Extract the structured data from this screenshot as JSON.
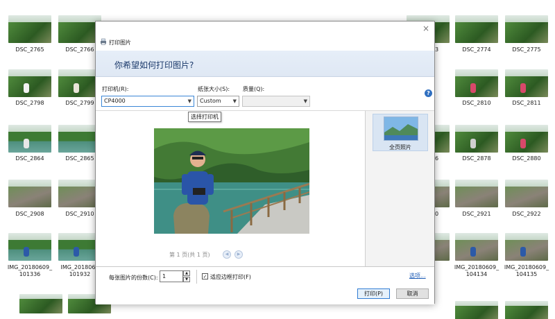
{
  "gallery": {
    "labels": [
      "DSC_2765",
      "DSC_2766",
      "73",
      "DSC_2774",
      "DSC_2775",
      "DSC_2798",
      "DSC_2799",
      "DSC_2810",
      "DSC_2811",
      "DSC_2864",
      "DSC_2865",
      "76",
      "DSC_2878",
      "DSC_2880",
      "DSC_2908",
      "DSC_2910",
      "20",
      "DSC_2921",
      "DSC_2922"
    ],
    "img_left": [
      "IMG_20180609_",
      "101336"
    ],
    "img_mid": [
      "IMG_2018060",
      "101932"
    ],
    "img_right1": [
      "IMG_20180609_",
      "104134"
    ],
    "img_right2": [
      "IMG_20180609_",
      "104135"
    ]
  },
  "dialog": {
    "title": "打印图片",
    "close_glyph": "×",
    "heading": "你希望如何打印图片?",
    "printer_label": "打印机(R):",
    "printer_value": "CP4000",
    "paper_label": "纸张大小(S):",
    "paper_value": "Custom",
    "quality_label": "质量(Q):",
    "quality_value": "",
    "help_glyph": "?",
    "tooltip": "选择打印机",
    "page_info": "第 1 页(共 1 页)",
    "prev_glyph": "◀",
    "next_glyph": "▶",
    "layout_label": "全页照片",
    "copies_label": "每张图片的份数(C):",
    "copies_value": "1",
    "fit_label": "适应边框打印(F)",
    "fit_checked": true,
    "check_glyph": "✓",
    "options_link": "选项...",
    "print_button": "打印(P)",
    "cancel_button": "取消"
  },
  "colors": {
    "banner": "#e6eef8",
    "accent": "#2f7bd3",
    "link": "#1c5bb5"
  }
}
